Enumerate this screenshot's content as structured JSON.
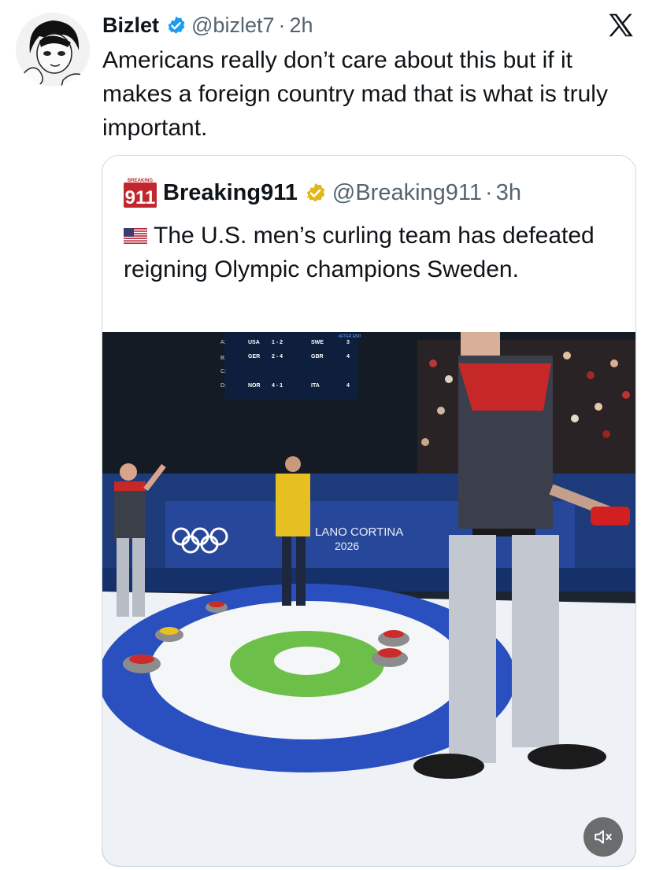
{
  "post": {
    "author_name": "Bizlet",
    "handle": "@bizlet7",
    "separator": "·",
    "time": "2h",
    "text": "Americans really don’t care about this but if it makes a foreign country mad that is what is truly important."
  },
  "quoted_post": {
    "logo_top": "BREAKING",
    "logo_number": "911",
    "author_name": "Breaking911",
    "handle": "@Breaking911",
    "separator": "·",
    "time": "3h",
    "text": "The U.S. men’s curling team has defeated reigning Olympic champions Sweden."
  },
  "scoreboard": {
    "header": "AFTER END",
    "row_letters": [
      "A:",
      "B:",
      "C:",
      "D:"
    ],
    "rows": [
      {
        "team1": "USA",
        "score": "1 - 2",
        "team2": "SWE",
        "end": "3"
      },
      {
        "team1": "GER",
        "score": "2 - 4",
        "team2": "GBR",
        "end": "4"
      },
      {
        "team1": "NOR",
        "score": "4 - 1",
        "team2": "ITA",
        "end": "4"
      }
    ]
  },
  "banner": {
    "line1": "LANO CORTINA",
    "line2": "2026"
  },
  "icons": {
    "verified_post": "verified-badge-blue",
    "verified_quote": "verified-badge-gold",
    "close": "x-logo",
    "mute": "speaker-muted"
  },
  "colors": {
    "verified_blue": "#1d9bf0",
    "verified_gold": "#e2b719",
    "text_primary": "#0f1419",
    "text_secondary": "#536471",
    "border": "#cfd9de"
  }
}
